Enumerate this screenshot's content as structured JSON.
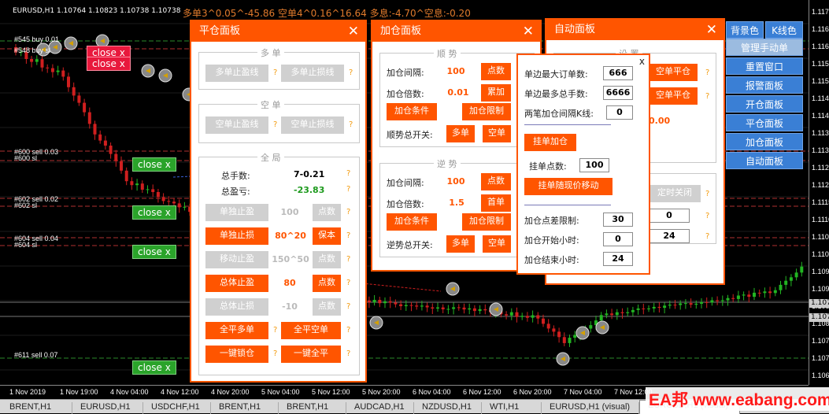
{
  "chart": {
    "symbol_info": "EURUSD,H1  1.10764 1.10823 1.10738 1.10738",
    "stats": "多单3^0.05^-45.86  空单4^0.16^16.64  多息:-4.70^空息:-0.20",
    "order_labels": [
      {
        "text": "#545 buy 0.01"
      },
      {
        "text": "#548 buy sl"
      },
      {
        "text": "#600 sell 0.03"
      },
      {
        "text": "#600 sl"
      },
      {
        "text": "#602 sell 0.02"
      },
      {
        "text": "#602 sl"
      },
      {
        "text": "#604 sell 0.04"
      },
      {
        "text": "#604 sl"
      },
      {
        "text": "#611 sell 0.07"
      }
    ],
    "close_buttons": [
      "close x",
      "close x",
      "close x",
      "close x",
      "close x",
      "close x"
    ],
    "price_ticks": [
      "1.1170",
      "1.1165",
      "1.1160",
      "1.1155",
      "1.1150",
      "1.1145",
      "1.1140",
      "1.1135",
      "1.1130",
      "1.1125",
      "1.1120",
      "1.1115",
      "1.1110",
      "1.1105",
      "1.1100",
      "1.1095",
      "1.1090",
      "1.1085",
      "1.1080",
      "1.1075",
      "1.1070",
      "1.1065"
    ],
    "price_highlight": [
      "1.1074",
      "1.1070"
    ],
    "time_ticks": [
      "1 Nov 2019",
      "1 Nov 19:00",
      "4 Nov 04:00",
      "4 Nov 12:00",
      "4 Nov 20:00",
      "5 Nov 04:00",
      "5 Nov 12:00",
      "5 Nov 20:00",
      "6 Nov 04:00",
      "6 Nov 12:00",
      "6 Nov 20:00",
      "7 Nov 04:00",
      "7 Nov 12:00"
    ]
  },
  "tabs": [
    "BRENT,H1",
    "EURUSD,H1",
    "USDCHF,H1",
    "BRENT,H1",
    "BRENT,H1",
    "AUDCAD,H1",
    "NZDUSD,H1",
    "WTI,H1",
    "EURUSD,H1 (visual)",
    "EURUSD,H1 (visual)"
  ],
  "watermark": "EA邦 www.eabang.com",
  "close_panel": {
    "title": "平仓面板",
    "close": "✕",
    "long_group": "多 单",
    "long_tp": "多单止盈线",
    "long_sl": "多单止损线",
    "short_group": "空 单",
    "short_tp": "空单止盈线",
    "short_sl": "空单止损线",
    "total_group": "全 局",
    "total_lots_label": "总手数:",
    "total_lots_value": "7-0.21",
    "total_pl_label": "总盈亏:",
    "total_pl_value": "-23.83",
    "single_tp": "单独止盈",
    "single_tp_value": "100",
    "single_tp_unit": "点数",
    "single_sl": "单独止损",
    "single_sl_value": "80^20",
    "single_sl_unit": "保本",
    "trail_tp": "移动止盈",
    "trail_tp_value": "150^50",
    "trail_tp_unit": "点数",
    "total_tp": "总体止盈",
    "total_tp_value": "80",
    "total_tp_unit": "点数",
    "total_sl": "总体止损",
    "total_sl_value": "-10",
    "total_sl_unit": "点数",
    "close_all_long": "全平多单",
    "close_all_short": "全平空单",
    "lock": "一键锁仓",
    "close_all": "一键全平",
    "q": "?"
  },
  "add_panel": {
    "title": "加仓面板",
    "close": "✕",
    "trend_group": "顺 势",
    "t_interval_label": "加仓间隔:",
    "t_interval_value": "100",
    "t_interval_unit": "点数",
    "t_mult_label": "加仓倍数:",
    "t_mult_value": "0.01",
    "t_mult_unit": "累加",
    "t_cond": "加仓条件",
    "t_limit": "加仓限制",
    "t_switch_label": "顺势总开关:",
    "t_long": "多单",
    "t_short": "空单",
    "counter_group": "逆 势",
    "c_interval_label": "加仓间隔:",
    "c_interval_value": "100",
    "c_interval_unit": "点数",
    "c_mult_label": "加仓倍数:",
    "c_mult_value": "1.5",
    "c_mult_unit": "首单",
    "c_cond": "加仓条件",
    "c_limit": "加仓限制",
    "c_switch_label": "逆势总开关:",
    "c_long": "多单",
    "c_short": "空单",
    "q": "?"
  },
  "auto_panel": {
    "title": "自动面板",
    "close": "✕",
    "group": "设 置",
    "btn_long_close": "空单平仓",
    "btn_short_close": "空单平仓",
    "value_a": "0.00",
    "timed_close": "定时关闭",
    "value_b": "0",
    "value_c": "24",
    "q": "?"
  },
  "limit_popup": {
    "close": "x",
    "max_orders_label": "单边最大订单数:",
    "max_orders_value": "666",
    "max_lots_label": "单边最多总手数:",
    "max_lots_value": "6666",
    "bar_interval_label": "两笔加仓间隔K线:",
    "bar_interval_value": "0",
    "pending_btn": "挂单加仓",
    "pending_points_label": "挂单点数:",
    "pending_points_value": "100",
    "follow_btn": "挂单随现价移动",
    "spread_label": "加仓点差限制:",
    "spread_value": "30",
    "start_hour_label": "加仓开始小时:",
    "start_hour_value": "0",
    "end_hour_label": "加仓结束小时:",
    "end_hour_value": "24"
  },
  "right_menu": {
    "bg_color": "背景色",
    "k_color": "K线色",
    "items": [
      "管理手动单",
      "重置窗口",
      "报警面板",
      "开仓面板",
      "平仓面板",
      "加仓面板",
      "自动面板"
    ]
  }
}
